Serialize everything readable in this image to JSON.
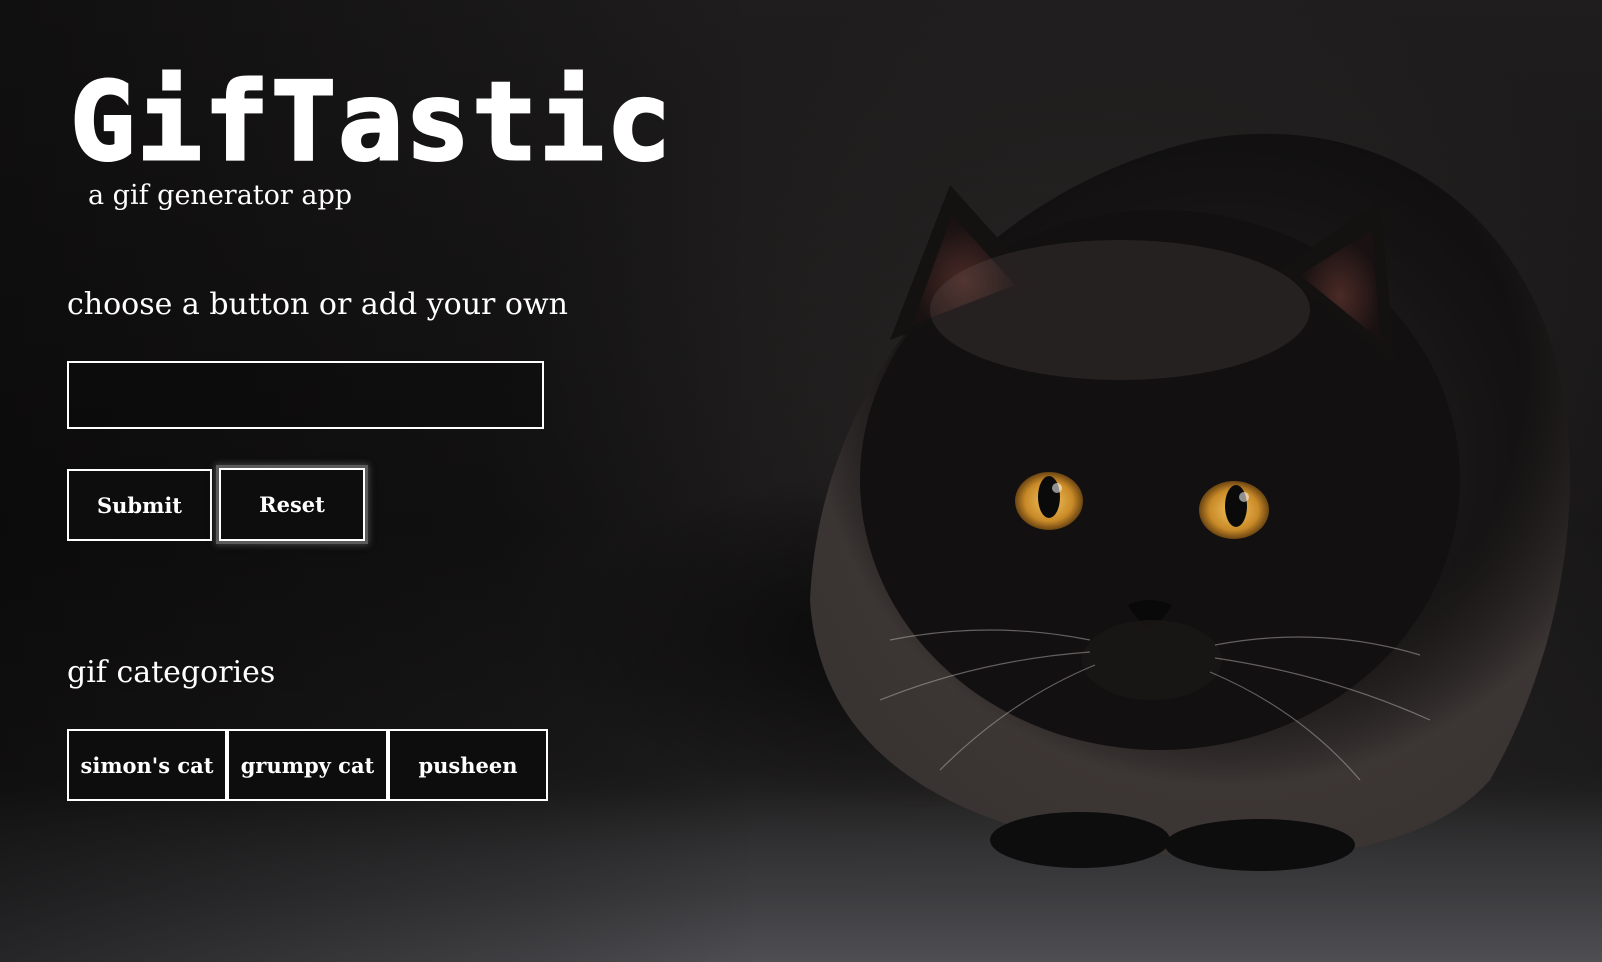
{
  "header": {
    "title": "GifTastic",
    "subtitle": "a gif generator app"
  },
  "add_section": {
    "heading": "choose a button or add your own",
    "input_value": "",
    "input_placeholder": "",
    "submit_label": "Submit",
    "reset_label": "Reset"
  },
  "categories_section": {
    "heading": "gif categories",
    "buttons": [
      {
        "label": "simon's cat"
      },
      {
        "label": "grumpy cat"
      },
      {
        "label": "pusheen"
      }
    ]
  },
  "background": {
    "subject": "black-cat-photo",
    "eye_color": "#d9a23a"
  },
  "colors": {
    "text": "#ffffff",
    "button_bg": "#0d0d0d",
    "border": "#ffffff",
    "focus_ring": "#5a5a5a"
  }
}
